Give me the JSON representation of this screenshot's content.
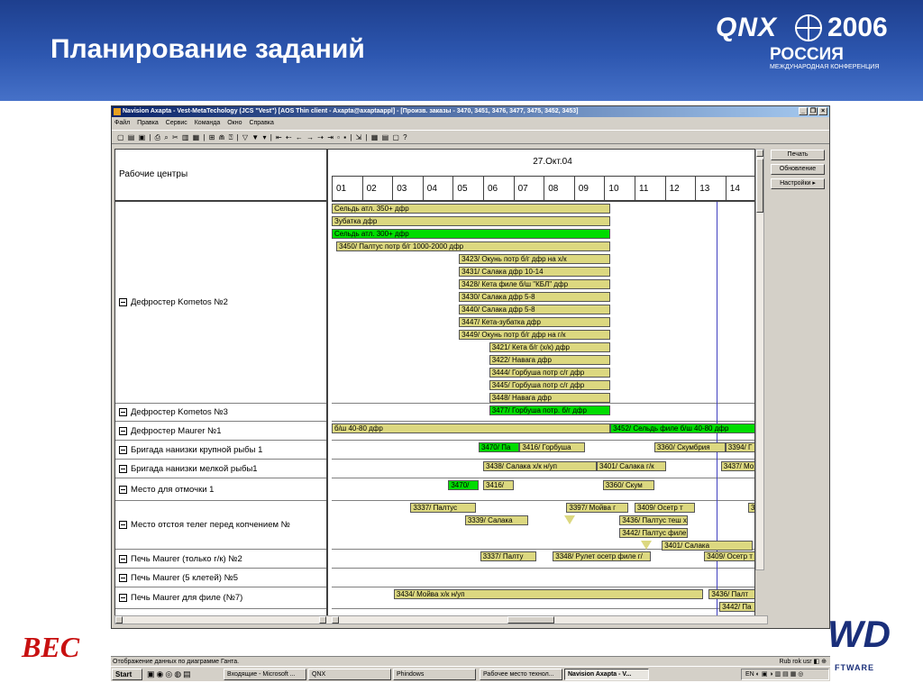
{
  "slide": {
    "title": "Планирование заданий",
    "logo_qnx": "QNX",
    "logo_year": "2006",
    "logo_country": "РОССИЯ",
    "logo_sub": "МЕЖДУНАРОДНАЯ КОНФЕРЕНЦИЯ",
    "left_logo": "BEC",
    "right_logo": "WD",
    "right_logo_sub": "FTWARE"
  },
  "window": {
    "title": "Navision Axapta - Vest-MetaTechology (JCS \"Vest\") [AOS Thin client - Axapta@axaptaappl] - [Произв. заказы - 3470, 3451, 3476, 3477, 3475, 3452, 3453]",
    "controls": [
      "_",
      "❐",
      "×"
    ],
    "menu": [
      "Файл",
      "Правка",
      "Сервис",
      "Команда",
      "Окно",
      "Справка"
    ],
    "toolbar_glyphs": "▢ ▤ ▣ | ⎙ ⌕ ✂ ▥ ▦ | ⊞ ⋒ ⍰ | ▽ ▼ ▾ | ⇤ ⇠ ← → ⇢ ⇥ ▫ ▪ | ⇲ | ▦ ▤ ▢ ?",
    "side_buttons": [
      "Печать",
      "Обновление",
      "Настройки ▸"
    ]
  },
  "gantt": {
    "left_header": "Рабочие центры",
    "date": "27.Окт.04",
    "hours": [
      "01",
      "02",
      "03",
      "04",
      "05",
      "06",
      "07",
      "08",
      "09",
      "10",
      "11",
      "12",
      "13",
      "14"
    ],
    "rows": [
      {
        "label": "Дефростер Kometos №2"
      },
      {
        "label": "Дефростер Kometos №3"
      },
      {
        "label": "Дефростер Maurer №1"
      },
      {
        "label": "Бригада нанизки крупной рыбы 1"
      },
      {
        "label": "Бригада нанизки мелкой рыбы1"
      },
      {
        "label": "Место для отмочки 1"
      },
      {
        "label": "Место отстоя телег  перед копчением №"
      },
      {
        "label": "Печь Maurer (только г/к) №2"
      },
      {
        "label": "Печь Maurer (5 клетей) №5"
      },
      {
        "label": "Печь Maurer для филе (№7)"
      }
    ],
    "tasks": [
      {
        "text": "Сельдь атл. 350+ дфр",
        "row": 0,
        "lane": 0,
        "start": 0.0,
        "end": 9.2,
        "color": "khaki"
      },
      {
        "text": "Зубатка  дфр",
        "row": 0,
        "lane": 1,
        "start": 0.0,
        "end": 9.2,
        "color": "khaki"
      },
      {
        "text": "Сельдь атл. 300+ дфр",
        "row": 0,
        "lane": 2,
        "start": 0.0,
        "end": 9.2,
        "color": "green"
      },
      {
        "text": "3450/ Палтус потр б/г 1000-2000 дфр",
        "row": 0,
        "lane": 3,
        "start": 0.15,
        "end": 9.2,
        "color": "khaki"
      },
      {
        "text": "3423/ Окунь потр б/г дфр на х/к",
        "row": 0,
        "lane": 4,
        "start": 4.2,
        "end": 9.2,
        "color": "khaki"
      },
      {
        "text": "3431/ Салака дфр  10-14",
        "row": 0,
        "lane": 5,
        "start": 4.2,
        "end": 9.2,
        "color": "khaki"
      },
      {
        "text": "3428/ Кета филе б/ш \"КБЛ\" дфр",
        "row": 0,
        "lane": 6,
        "start": 4.2,
        "end": 9.2,
        "color": "khaki"
      },
      {
        "text": "3430/ Салака  дфр 5-8",
        "row": 0,
        "lane": 7,
        "start": 4.2,
        "end": 9.2,
        "color": "khaki"
      },
      {
        "text": "3440/ Салака  дфр 5-8",
        "row": 0,
        "lane": 8,
        "start": 4.2,
        "end": 9.2,
        "color": "khaki"
      },
      {
        "text": "3447/ Кета-зубатка дфр",
        "row": 0,
        "lane": 9,
        "start": 4.2,
        "end": 9.2,
        "color": "khaki"
      },
      {
        "text": "3449/ Окунь потр б/г дфр на г/к",
        "row": 0,
        "lane": 10,
        "start": 4.2,
        "end": 9.2,
        "color": "khaki"
      },
      {
        "text": "3421/ Кета  б/г  (х/к) дфр",
        "row": 0,
        "lane": 11,
        "start": 5.2,
        "end": 9.2,
        "color": "khaki"
      },
      {
        "text": "3422/ Навага дфр",
        "row": 0,
        "lane": 12,
        "start": 5.2,
        "end": 9.2,
        "color": "khaki"
      },
      {
        "text": "3444/ Горбуша потр с/г дфр",
        "row": 0,
        "lane": 13,
        "start": 5.2,
        "end": 9.2,
        "color": "khaki"
      },
      {
        "text": "3445/ Горбуша потр с/г дфр",
        "row": 0,
        "lane": 14,
        "start": 5.2,
        "end": 9.2,
        "color": "khaki"
      },
      {
        "text": "3448/ Навага дфр",
        "row": 0,
        "lane": 15,
        "start": 5.2,
        "end": 9.2,
        "color": "khaki"
      },
      {
        "text": "3477/ Горбуша  потр. б/г  дфр",
        "row": 1,
        "lane": 0,
        "start": 5.2,
        "end": 9.2,
        "color": "green"
      },
      {
        "text": "б/ш 40-80 дфр",
        "row": 2,
        "lane": 0,
        "start": 0.0,
        "end": 9.2,
        "color": "khaki"
      },
      {
        "text": "3452/ Сельдь  филе   б/ш 40-80 дфр",
        "row": 2,
        "lane": 0,
        "start": 9.2,
        "end": 14.0,
        "color": "green"
      },
      {
        "text": "3470/ Па",
        "row": 3,
        "lane": 0,
        "start": 4.85,
        "end": 6.2,
        "color": "green"
      },
      {
        "text": "3416/ Горбуша",
        "row": 3,
        "lane": 0,
        "start": 6.2,
        "end": 8.35,
        "color": "khaki"
      },
      {
        "text": "3360/ Скумбрия",
        "row": 3,
        "lane": 0,
        "start": 10.65,
        "end": 13.0,
        "color": "khaki"
      },
      {
        "text": "3394/ Г",
        "row": 3,
        "lane": 0,
        "start": 13.0,
        "end": 14.0,
        "color": "khaki"
      },
      {
        "text": "3438/ Салака х/к н/уп",
        "row": 4,
        "lane": 0,
        "start": 5.0,
        "end": 8.75,
        "color": "khaki"
      },
      {
        "text": "3401/ Салака г/к",
        "row": 4,
        "lane": 0,
        "start": 8.75,
        "end": 11.05,
        "color": "khaki"
      },
      {
        "text": "3437/ Мо",
        "row": 4,
        "lane": 0,
        "start": 12.85,
        "end": 14.0,
        "color": "khaki"
      },
      {
        "text": "3470/",
        "row": 5,
        "lane": 0,
        "start": 3.85,
        "end": 4.85,
        "color": "green"
      },
      {
        "text": "3416/",
        "row": 5,
        "lane": 0,
        "start": 5.0,
        "end": 6.0,
        "color": "khaki"
      },
      {
        "text": "3360/ Скум",
        "row": 5,
        "lane": 0,
        "start": 8.95,
        "end": 10.65,
        "color": "khaki"
      },
      {
        "text": "3337/ Палтус",
        "row": 6,
        "lane": 0,
        "start": 2.6,
        "end": 4.75,
        "color": "khaki"
      },
      {
        "text": "3397/ Мойва г",
        "row": 6,
        "lane": 0,
        "start": 7.75,
        "end": 9.8,
        "color": "khaki"
      },
      {
        "text": "3409/ Осетр   т",
        "row": 6,
        "lane": 0,
        "start": 10.0,
        "end": 12.0,
        "color": "khaki"
      },
      {
        "text": "3",
        "row": 6,
        "lane": 0,
        "start": 13.75,
        "end": 14.0,
        "color": "khaki"
      },
      {
        "text": "3339/ Салака",
        "row": 6,
        "lane": 1,
        "start": 4.4,
        "end": 6.5,
        "color": "khaki"
      },
      {
        "text": "3436/ Палтус   теш  х/к",
        "row": 6,
        "lane": 1,
        "start": 9.5,
        "end": 11.75,
        "color": "khaki"
      },
      {
        "text": "3442/ Палтус   филе  х",
        "row": 6,
        "lane": 2,
        "start": 9.5,
        "end": 11.75,
        "color": "khaki"
      },
      {
        "text": "3401/ Салака",
        "row": 6,
        "lane": 3,
        "start": 10.9,
        "end": 13.9,
        "color": "khaki"
      },
      {
        "text": "3337/ Палту",
        "row": 7,
        "lane": 0,
        "start": 4.9,
        "end": 6.75,
        "color": "khaki"
      },
      {
        "text": "3348/ Рулет осетр филе г/",
        "row": 7,
        "lane": 0,
        "start": 7.3,
        "end": 10.55,
        "color": "khaki"
      },
      {
        "text": "3409/ Осетр  т",
        "row": 7,
        "lane": 0,
        "start": 12.3,
        "end": 14.0,
        "color": "khaki"
      },
      {
        "text": "3434/ Мойва х/к н/уп",
        "row": 9,
        "lane": 0,
        "start": 2.05,
        "end": 12.25,
        "color": "khaki"
      },
      {
        "text": "3436/ Палт",
        "row": 9,
        "lane": 0,
        "start": 12.45,
        "end": 14.0,
        "color": "khaki"
      },
      {
        "text": "3442/ Па",
        "row": 9,
        "lane": 1,
        "start": 12.8,
        "end": 14.0,
        "color": "khaki"
      }
    ],
    "markers": [
      {
        "row": 6,
        "lane": 1,
        "at": 7.85
      },
      {
        "row": 6,
        "lane": 3,
        "at": 10.4
      }
    ],
    "now_hour": 12.7
  },
  "statusbar": {
    "text": "Отображение данных по диаграмме Ганта.",
    "right": "Rub   rok   usr   ◧  ⊕"
  },
  "taskbar": {
    "start": "Start",
    "quicklaunch": "▣◉◎◍▤",
    "tasks": [
      "Входящие - Microsoft ...",
      "QNX",
      "Phindows",
      "Рабочее место технол...",
      "Navision Axapta - V..."
    ],
    "tray": "EN ◐ ▣ ◑ ▥ ▤ ▦ ◎"
  }
}
